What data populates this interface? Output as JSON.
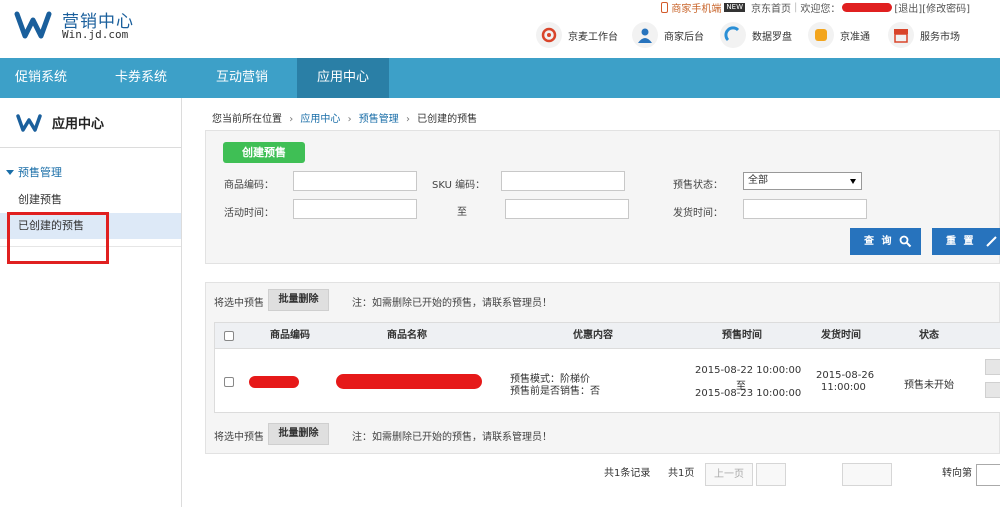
{
  "header": {
    "logo_title": "营销中心",
    "logo_sub": "Win.jd.com",
    "toplinks": {
      "mobile": "商家手机端",
      "new_badge": "NEW",
      "home": "京东首页",
      "welcome": "欢迎您：",
      "logout": "[退出]",
      "change_password": "[修改密码]"
    },
    "quick_links": [
      "京麦工作台",
      "商家后台",
      "数据罗盘",
      "京准通",
      "服务市场"
    ]
  },
  "nav": {
    "items": [
      "促销系统",
      "卡券系统",
      "互动营销",
      "应用中心"
    ],
    "active": "应用中心"
  },
  "sidebar": {
    "title": "应用中心",
    "group": "预售管理",
    "items": [
      "创建预售",
      "已创建的预售"
    ],
    "active": "已创建的预售"
  },
  "breadcrumb": {
    "prefix": "您当前所在位置",
    "items": [
      "应用中心",
      "预售管理",
      "已创建的预售"
    ]
  },
  "filter": {
    "create_button": "创建预售",
    "product_code_label": "商品编码：",
    "sku_code_label": "SKU 编码：",
    "status_label": "预售状态：",
    "status_value": "全部",
    "time_label": "活动时间：",
    "to_label": "至",
    "ship_time_label": "发货时间：",
    "search_button": "查 询",
    "reset_button": "重 置"
  },
  "list": {
    "select_label": "将选中预售",
    "batch_delete": "批量删除",
    "note": "注：如需删除已开始的预售，请联系管理员！",
    "columns": [
      "商品编码",
      "商品名称",
      "优惠内容",
      "预售时间",
      "发货时间",
      "状态"
    ],
    "rows": [
      {
        "discount_line1": "预售模式：阶梯价",
        "discount_line2": "预售前是否销售：否",
        "presale_start": "2015-08-22 10:00:00",
        "presale_to": "至",
        "presale_end": "2015-08-23 10:00:00",
        "ship_date": "2015-08-26",
        "ship_time": "11:00:00",
        "status": "预售未开始"
      }
    ]
  },
  "pager": {
    "total": "共1条记录",
    "pages": "共1页",
    "prev": "上一页",
    "goto": "转向第"
  },
  "colors": {
    "nav_bg": "#3da0c8",
    "nav_active": "#2a7fa6",
    "create_button": "#3fbf55",
    "action_button": "#2773bd",
    "highlight": "#e02020"
  }
}
